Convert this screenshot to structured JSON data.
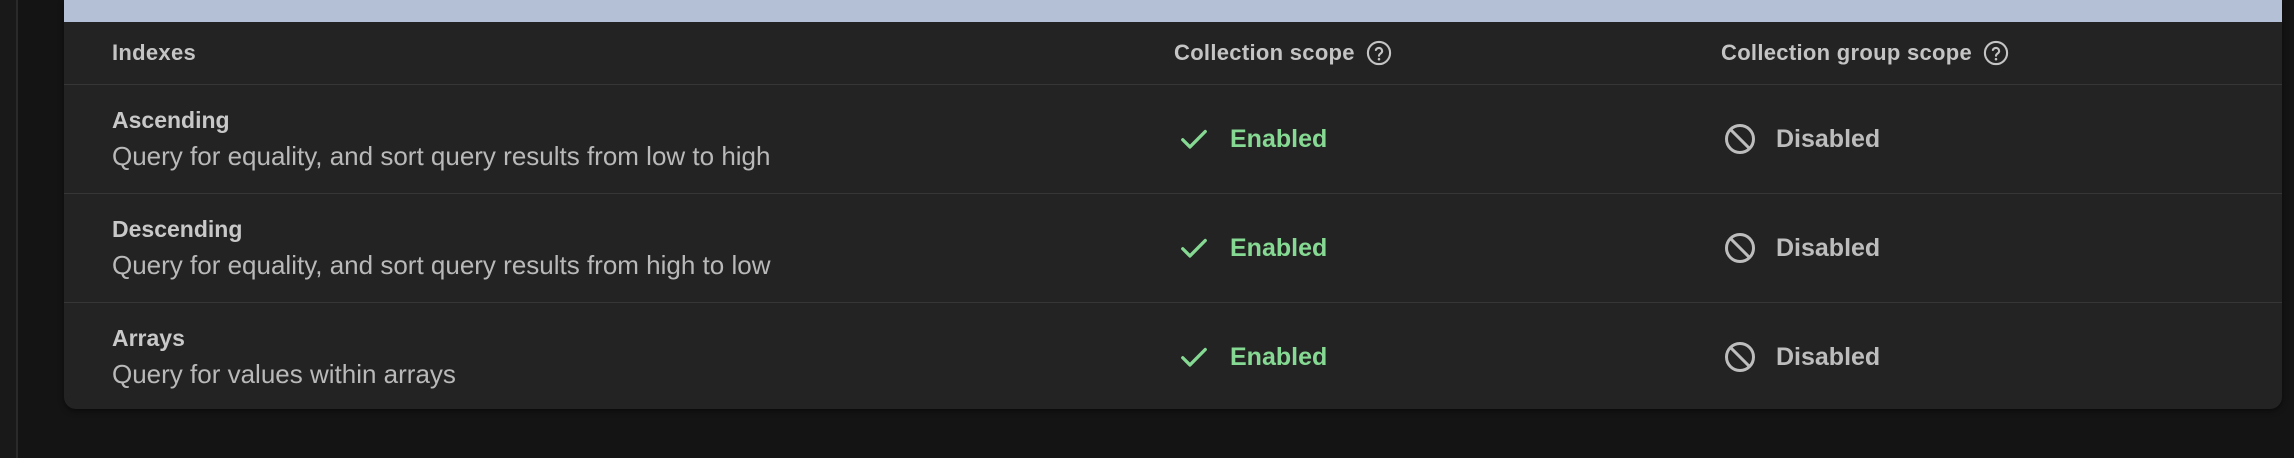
{
  "table": {
    "headers": {
      "indexes": "Indexes",
      "collection_scope": "Collection scope",
      "collection_group_scope": "Collection group scope"
    },
    "rows": [
      {
        "name": "Ascending",
        "description": "Query for equality, and sort query results from low to high",
        "collection_scope": "Enabled",
        "collection_group_scope": "Disabled"
      },
      {
        "name": "Descending",
        "description": "Query for equality, and sort query results from high to low",
        "collection_scope": "Enabled",
        "collection_group_scope": "Disabled"
      },
      {
        "name": "Arrays",
        "description": "Query for values within arrays",
        "collection_scope": "Enabled",
        "collection_group_scope": "Disabled"
      }
    ]
  },
  "icons": {
    "help": "help-circle-icon",
    "enabled": "check-icon",
    "disabled": "block-icon"
  },
  "colors": {
    "enabled": "#86d993",
    "disabled": "#bdbdbd",
    "top_bar": "#b3c0d6",
    "card": "#232323"
  }
}
